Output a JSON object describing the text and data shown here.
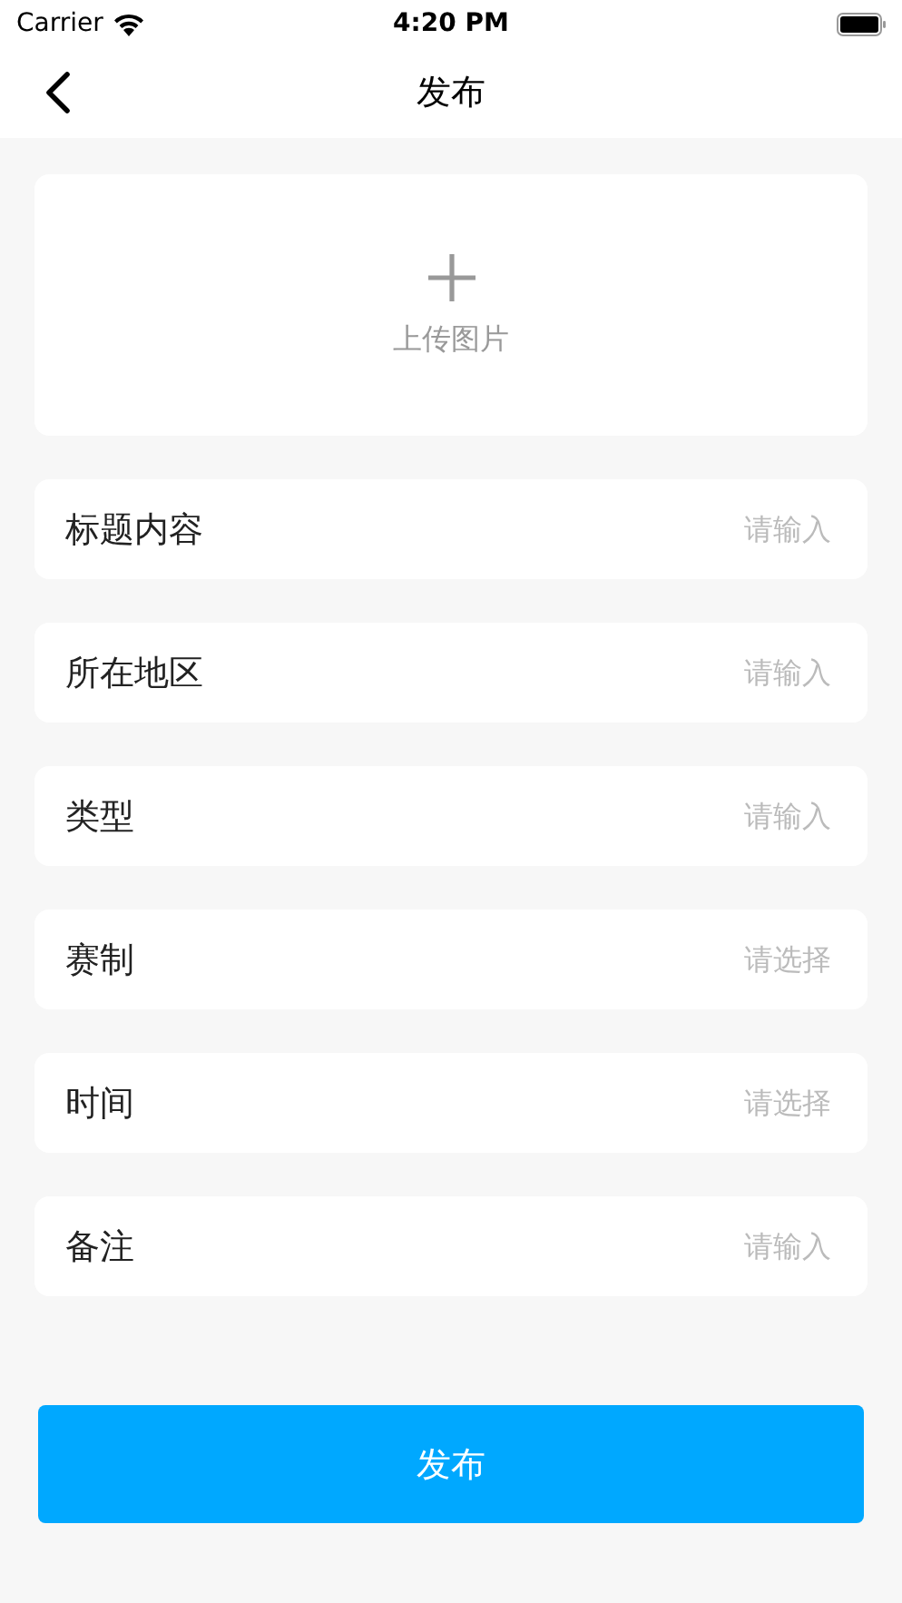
{
  "status_bar": {
    "carrier": "Carrier",
    "time": "4:20 PM"
  },
  "nav": {
    "title": "发布"
  },
  "upload": {
    "label": "上传图片"
  },
  "fields": [
    {
      "label": "标题内容",
      "placeholder": "请输入"
    },
    {
      "label": "所在地区",
      "placeholder": "请输入"
    },
    {
      "label": "类型",
      "placeholder": "请输入"
    },
    {
      "label": "赛制",
      "placeholder": "请选择"
    },
    {
      "label": "时间",
      "placeholder": "请选择"
    },
    {
      "label": "备注",
      "placeholder": "请输入"
    }
  ],
  "submit": {
    "label": "发布"
  }
}
